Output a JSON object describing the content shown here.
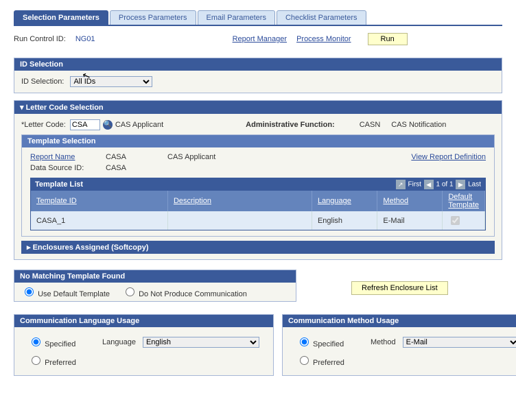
{
  "tabs": {
    "selection": "Selection Parameters",
    "process": "Process Parameters",
    "email": "Email Parameters",
    "checklist": "Checklist Parameters"
  },
  "run": {
    "label": "Run Control ID:",
    "value": "NG01",
    "report_manager": "Report Manager",
    "process_monitor": "Process Monitor",
    "run_btn": "Run"
  },
  "id_selection": {
    "hdr": "ID Selection",
    "label": "ID Selection:",
    "value": "All IDs"
  },
  "letter": {
    "hdr": "Letter Code Selection",
    "code_label": "*Letter Code:",
    "code_value": "CSA",
    "code_desc": "CAS Applicant",
    "adm_func_label": "Administrative Function:",
    "adm_func_value": "CASN",
    "adm_func_desc": "CAS Notification"
  },
  "template_sel": {
    "hdr": "Template Selection",
    "report_name_lbl": "Report Name",
    "report_name_val": "CASA",
    "report_name_desc": "CAS Applicant",
    "view_def": "View Report Definition",
    "ds_lbl": "Data Source ID:",
    "ds_val": "CASA"
  },
  "template_list": {
    "title": "Template List",
    "nav_first": "First",
    "nav_count": "1 of 1",
    "nav_last": "Last",
    "col_template_id": "Template ID",
    "col_description": "Description",
    "col_language": "Language",
    "col_method": "Method",
    "col_default": "Default Template",
    "rows": [
      {
        "template_id": "CASA_1",
        "description": "",
        "language": "English",
        "method": "E-Mail",
        "default": true
      }
    ]
  },
  "enclosures": {
    "hdr": "Enclosures Assigned (Softcopy)"
  },
  "no_match": {
    "hdr": "No Matching Template Found",
    "use_default": "Use Default Template",
    "do_not": "Do Not Produce Communication",
    "refresh": "Refresh Enclosure List"
  },
  "lang_usage": {
    "hdr": "Communication Language Usage",
    "specified": "Specified",
    "preferred": "Preferred",
    "lang_lbl": "Language",
    "lang_val": "English"
  },
  "method_usage": {
    "hdr": "Communication Method Usage",
    "specified": "Specified",
    "preferred": "Preferred",
    "method_lbl": "Method",
    "method_val": "E-Mail"
  }
}
